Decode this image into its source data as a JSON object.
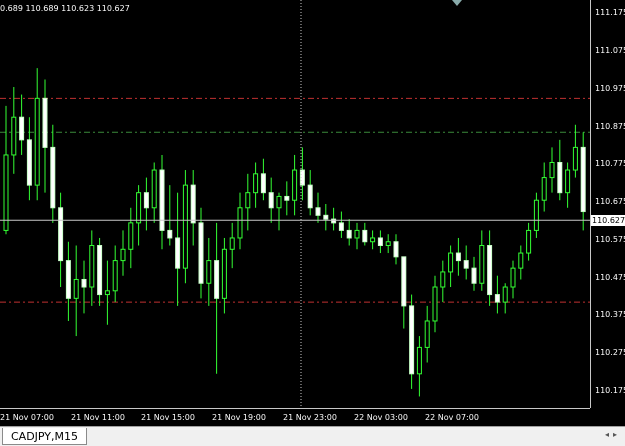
{
  "chart_data": {
    "type": "candlestick",
    "symbol": "CADJPY",
    "timeframe": "M15",
    "ohlc_header": "0.689 110.689 110.623 110.627",
    "ylim": [
      110.14,
      111.2
    ],
    "price_ticks": [
      "111.175",
      "111.075",
      "110.975",
      "110.875",
      "110.775",
      "110.675",
      "110.575",
      "110.475",
      "110.375",
      "110.275",
      "110.175"
    ],
    "time_ticks": [
      "21 Nov 07:00",
      "21 Nov 11:00",
      "21 Nov 15:00",
      "21 Nov 19:00",
      "21 Nov 23:00",
      "22 Nov 03:00",
      "22 Nov 07:00"
    ],
    "current_price": "110.627",
    "levels": [
      {
        "price": 110.95,
        "color": "#c03030"
      },
      {
        "price": 110.86,
        "color": "#3a8a3a"
      },
      {
        "price": 110.41,
        "color": "#c03030"
      }
    ],
    "candles": [
      [
        110.6,
        110.93,
        110.59,
        110.8
      ],
      [
        110.8,
        110.98,
        110.75,
        110.9
      ],
      [
        110.9,
        110.96,
        110.8,
        110.84
      ],
      [
        110.84,
        110.9,
        110.68,
        110.72
      ],
      [
        110.72,
        111.03,
        110.68,
        110.95
      ],
      [
        110.95,
        111.0,
        110.7,
        110.82
      ],
      [
        110.82,
        110.88,
        110.62,
        110.66
      ],
      [
        110.66,
        110.7,
        110.45,
        110.52
      ],
      [
        110.52,
        110.57,
        110.36,
        110.42
      ],
      [
        110.42,
        110.56,
        110.32,
        110.47
      ],
      [
        110.47,
        110.52,
        110.38,
        110.45
      ],
      [
        110.45,
        110.6,
        110.4,
        110.56
      ],
      [
        110.56,
        110.58,
        110.4,
        110.43
      ],
      [
        110.43,
        110.52,
        110.35,
        110.44
      ],
      [
        110.44,
        110.56,
        110.41,
        110.52
      ],
      [
        110.52,
        110.6,
        110.48,
        110.55
      ],
      [
        110.55,
        110.66,
        110.5,
        110.62
      ],
      [
        110.62,
        110.72,
        110.56,
        110.7
      ],
      [
        110.7,
        110.74,
        110.6,
        110.66
      ],
      [
        110.66,
        110.78,
        110.62,
        110.76
      ],
      [
        110.76,
        110.8,
        110.55,
        110.6
      ],
      [
        110.6,
        110.72,
        110.56,
        110.58
      ],
      [
        110.58,
        110.7,
        110.4,
        110.5
      ],
      [
        110.5,
        110.76,
        110.46,
        110.72
      ],
      [
        110.72,
        110.76,
        110.56,
        110.62
      ],
      [
        110.62,
        110.66,
        110.42,
        110.46
      ],
      [
        110.46,
        110.58,
        110.4,
        110.52
      ],
      [
        110.52,
        110.62,
        110.22,
        110.42
      ],
      [
        110.42,
        110.58,
        110.38,
        110.55
      ],
      [
        110.55,
        110.62,
        110.5,
        110.58
      ],
      [
        110.58,
        110.7,
        110.55,
        110.66
      ],
      [
        110.66,
        110.75,
        110.6,
        110.7
      ],
      [
        110.7,
        110.78,
        110.66,
        110.75
      ],
      [
        110.75,
        110.79,
        110.68,
        110.7
      ],
      [
        110.7,
        110.74,
        110.62,
        110.66
      ],
      [
        110.66,
        110.7,
        110.6,
        110.69
      ],
      [
        110.69,
        110.73,
        110.64,
        110.68
      ],
      [
        110.68,
        110.8,
        110.64,
        110.76
      ],
      [
        110.76,
        110.82,
        110.68,
        110.72
      ],
      [
        110.72,
        110.76,
        110.64,
        110.66
      ],
      [
        110.66,
        110.7,
        110.62,
        110.64
      ],
      [
        110.64,
        110.67,
        110.6,
        110.63
      ],
      [
        110.63,
        110.66,
        110.6,
        110.62
      ],
      [
        110.62,
        110.65,
        110.58,
        110.6
      ],
      [
        110.6,
        110.63,
        110.56,
        110.58
      ],
      [
        110.58,
        110.62,
        110.55,
        110.6
      ],
      [
        110.6,
        110.62,
        110.56,
        110.57
      ],
      [
        110.57,
        110.6,
        110.55,
        110.58
      ],
      [
        110.58,
        110.6,
        110.54,
        110.56
      ],
      [
        110.56,
        110.59,
        110.54,
        110.57
      ],
      [
        110.57,
        110.59,
        110.51,
        110.53
      ],
      [
        110.53,
        110.44,
        110.34,
        110.4
      ],
      [
        110.4,
        110.43,
        110.18,
        110.22
      ],
      [
        110.22,
        110.32,
        110.16,
        110.29
      ],
      [
        110.29,
        110.4,
        110.25,
        110.36
      ],
      [
        110.36,
        110.48,
        110.33,
        110.45
      ],
      [
        110.45,
        110.52,
        110.41,
        110.49
      ],
      [
        110.49,
        110.56,
        110.45,
        110.54
      ],
      [
        110.54,
        110.58,
        110.48,
        110.52
      ],
      [
        110.52,
        110.56,
        110.47,
        110.5
      ],
      [
        110.5,
        110.53,
        110.44,
        110.46
      ],
      [
        110.46,
        110.6,
        110.44,
        110.56
      ],
      [
        110.56,
        110.6,
        110.4,
        110.43
      ],
      [
        110.43,
        110.48,
        110.38,
        110.41
      ],
      [
        110.41,
        110.46,
        110.38,
        110.45
      ],
      [
        110.45,
        110.52,
        110.42,
        110.5
      ],
      [
        110.5,
        110.56,
        110.47,
        110.54
      ],
      [
        110.54,
        110.62,
        110.52,
        110.6
      ],
      [
        110.6,
        110.7,
        110.58,
        110.68
      ],
      [
        110.68,
        110.78,
        110.65,
        110.74
      ],
      [
        110.74,
        110.82,
        110.7,
        110.78
      ],
      [
        110.78,
        110.84,
        110.68,
        110.7
      ],
      [
        110.7,
        110.78,
        110.66,
        110.76
      ],
      [
        110.76,
        110.88,
        110.74,
        110.82
      ],
      [
        110.82,
        110.86,
        110.6,
        110.65
      ]
    ]
  },
  "tab": {
    "label": "CADJPY,M15"
  }
}
